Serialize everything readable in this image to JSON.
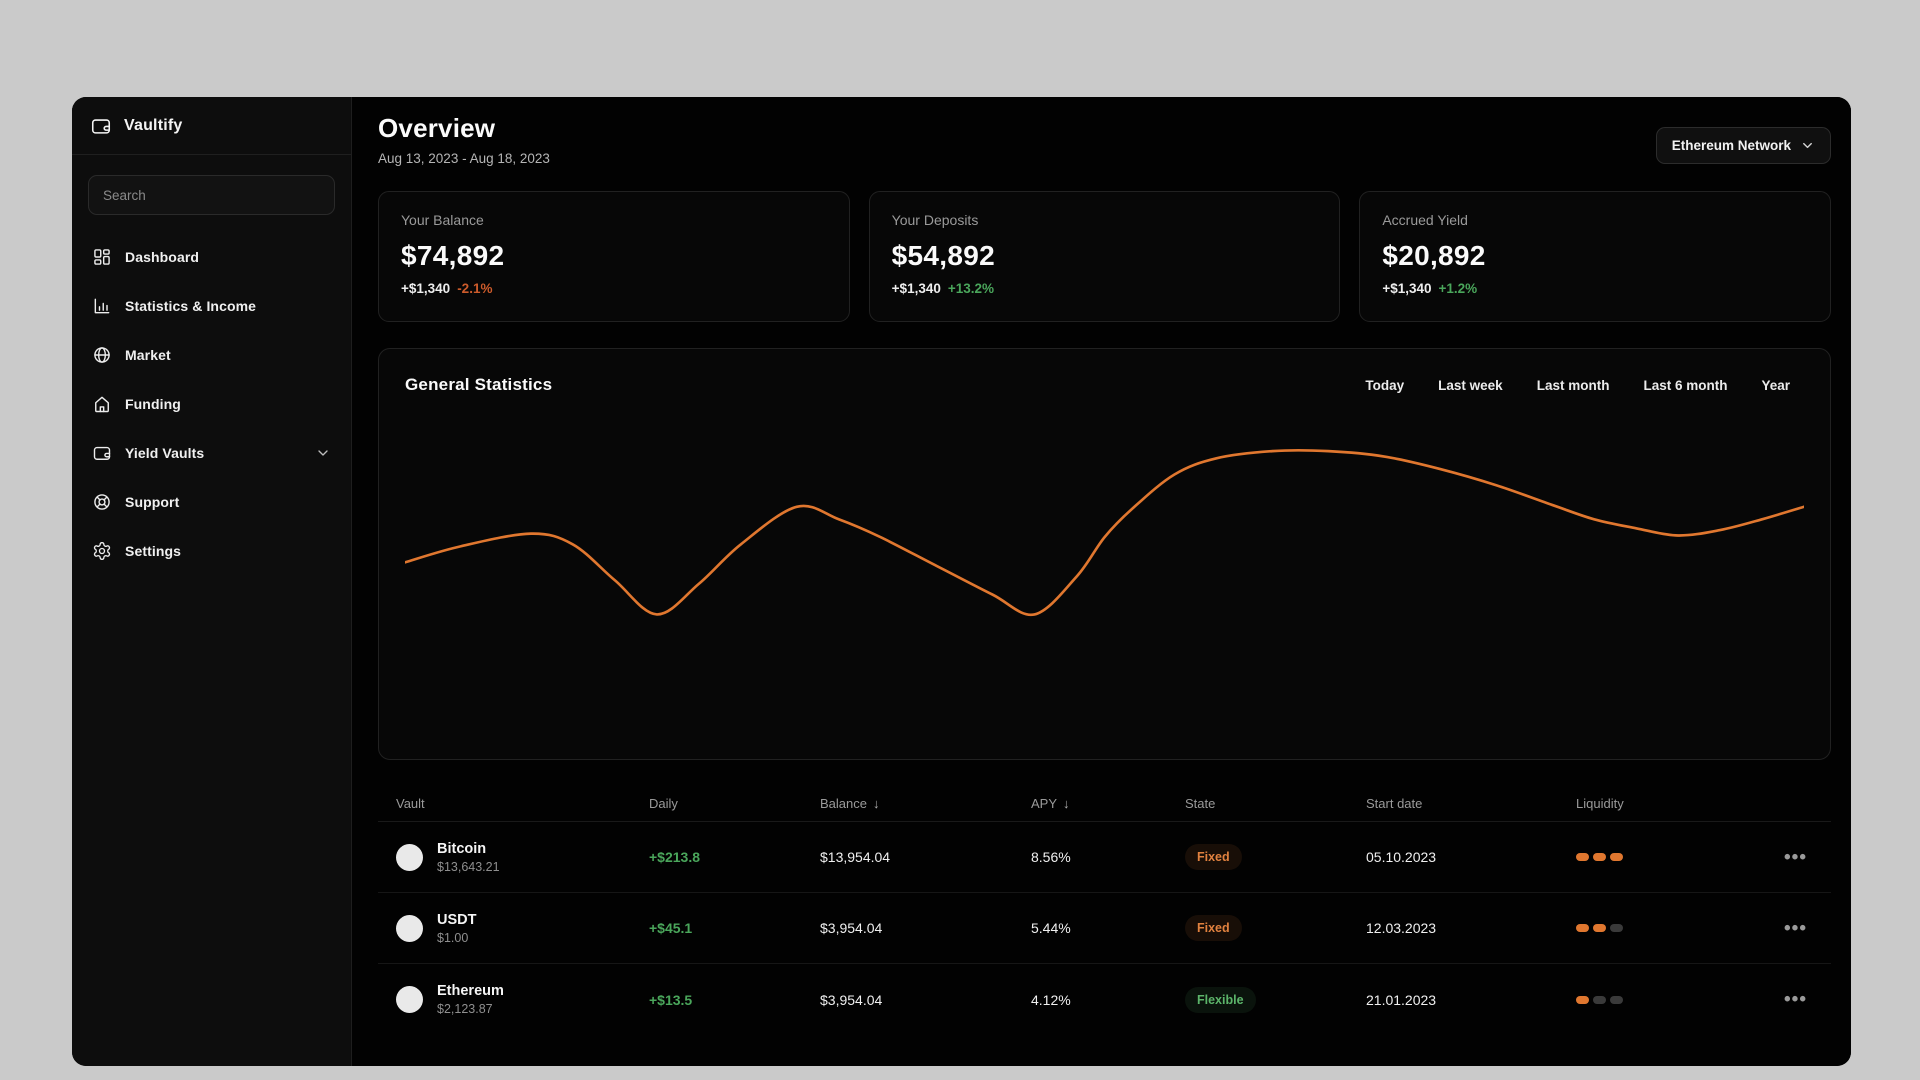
{
  "app": {
    "name": "Vaultify"
  },
  "sidebar": {
    "search_placeholder": "Search",
    "items": [
      {
        "label": "Dashboard",
        "icon": "dashboard-icon",
        "expandable": false
      },
      {
        "label": "Statistics & Income",
        "icon": "bar-chart-icon",
        "expandable": false
      },
      {
        "label": "Market",
        "icon": "globe-icon",
        "expandable": false
      },
      {
        "label": "Funding",
        "icon": "home-icon",
        "expandable": false
      },
      {
        "label": "Yield Vaults",
        "icon": "wallet-icon",
        "expandable": true
      },
      {
        "label": "Support",
        "icon": "lifebuoy-icon",
        "expandable": false
      },
      {
        "label": "Settings",
        "icon": "gear-icon",
        "expandable": false
      }
    ]
  },
  "header": {
    "title": "Overview",
    "date_range": "Aug 13, 2023 - Aug 18, 2023",
    "network_selector": "Ethereum Network"
  },
  "stat_cards": [
    {
      "label": "Your Balance",
      "value": "$74,892",
      "change_amount": "+$1,340",
      "change_pct": "-2.1%",
      "change_dir": "down"
    },
    {
      "label": "Your Deposits",
      "value": "$54,892",
      "change_amount": "+$1,340",
      "change_pct": "+13.2%",
      "change_dir": "up"
    },
    {
      "label": "Accrued Yield",
      "value": "$20,892",
      "change_amount": "+$1,340",
      "change_pct": "+1.2%",
      "change_dir": "up"
    }
  ],
  "statistics_panel": {
    "title": "General Statistics",
    "filters": [
      "Today",
      "Last week",
      "Last month",
      "Last 6 month",
      "Year"
    ]
  },
  "chart_data": {
    "type": "line",
    "title": "General Statistics",
    "xlabel": "",
    "ylabel": "",
    "grid": false,
    "axes_visible": false,
    "legend": "none",
    "line_color": "#e0772f",
    "x_range_label": "Aug 13, 2023 - Aug 18, 2023",
    "series": [
      {
        "name": "balance-trend",
        "points_pct": [
          [
            0,
            34
          ],
          [
            4,
            43
          ],
          [
            9,
            50
          ],
          [
            12,
            44
          ],
          [
            15,
            24
          ],
          [
            18,
            5
          ],
          [
            21,
            22
          ],
          [
            24,
            44
          ],
          [
            28,
            65
          ],
          [
            31,
            58
          ],
          [
            34,
            48
          ],
          [
            38,
            32
          ],
          [
            42,
            16
          ],
          [
            45,
            5
          ],
          [
            48,
            26
          ],
          [
            50,
            48
          ],
          [
            52,
            64
          ],
          [
            55,
            83
          ],
          [
            58,
            92
          ],
          [
            62,
            96
          ],
          [
            66,
            96
          ],
          [
            70,
            93
          ],
          [
            74,
            86
          ],
          [
            78,
            77
          ],
          [
            82,
            66
          ],
          [
            85,
            58
          ],
          [
            88,
            53
          ],
          [
            91,
            49
          ],
          [
            94,
            52
          ],
          [
            97,
            58
          ],
          [
            100,
            65
          ]
        ]
      }
    ]
  },
  "table": {
    "columns": [
      {
        "label": "Vault",
        "sort_icon": ""
      },
      {
        "label": "Daily",
        "sort_icon": ""
      },
      {
        "label": "Balance",
        "sort_icon": "↓"
      },
      {
        "label": "APY",
        "sort_icon": "↓"
      },
      {
        "label": "State",
        "sort_icon": ""
      },
      {
        "label": "Start date",
        "sort_icon": ""
      },
      {
        "label": "Liquidity",
        "sort_icon": ""
      },
      {
        "label": "",
        "sort_icon": ""
      }
    ],
    "actions_glyph": "•••",
    "rows": [
      {
        "name": "Bitcoin",
        "price": "$13,643.21",
        "daily": "+$213.8",
        "balance": "$13,954.04",
        "apy": "8.56%",
        "state": "Fixed",
        "state_type": "fixed",
        "start_date": "05.10.2023",
        "liquidity": 3
      },
      {
        "name": "USDT",
        "price": "$1.00",
        "daily": "+$45.1",
        "balance": "$3,954.04",
        "apy": "5.44%",
        "state": "Fixed",
        "state_type": "fixed",
        "start_date": "12.03.2023",
        "liquidity": 2
      },
      {
        "name": "Ethereum",
        "price": "$2,123.87",
        "daily": "+$13.5",
        "balance": "$3,954.04",
        "apy": "4.12%",
        "state": "Flexible",
        "state_type": "flexible",
        "start_date": "21.01.2023",
        "liquidity": 1
      }
    ]
  },
  "colors": {
    "accent_orange": "#e0772f",
    "positive_green": "#4aa65b",
    "negative_orange_red": "#cc5b2b",
    "page_background": "#cacaca",
    "window_background": "#020202"
  }
}
